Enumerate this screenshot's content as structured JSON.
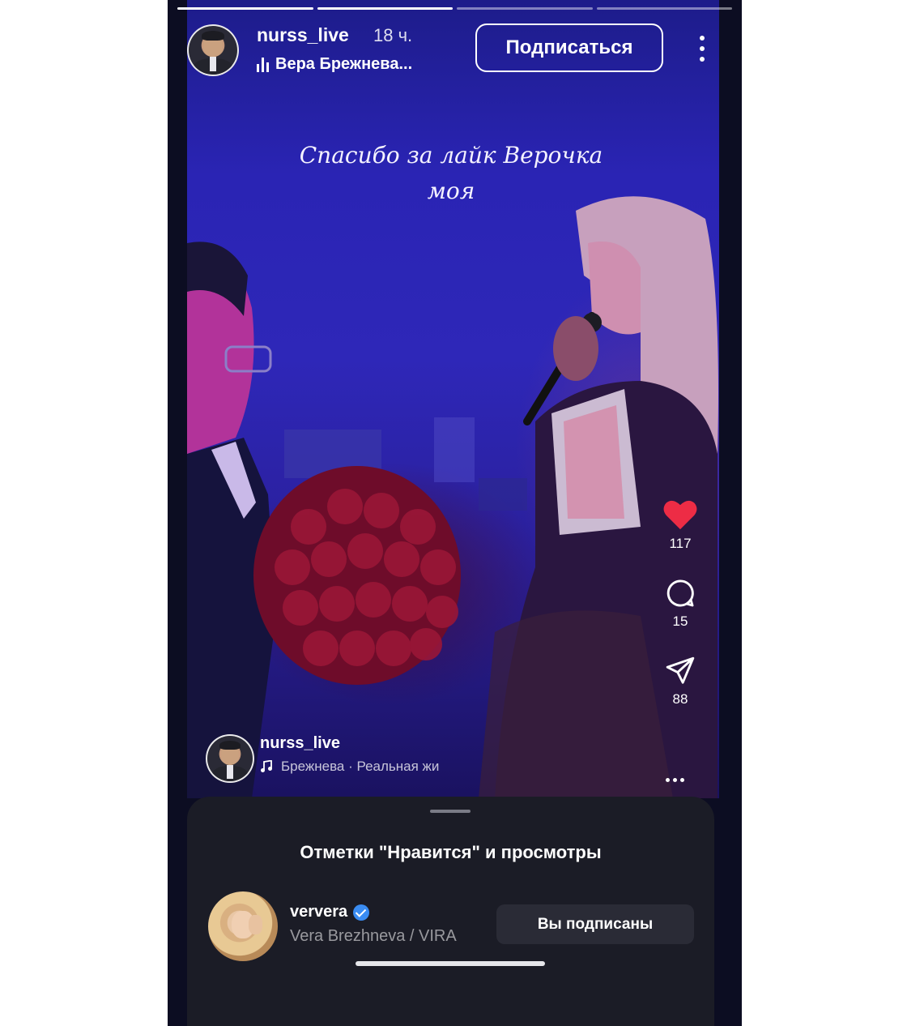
{
  "story": {
    "username": "nurss_live",
    "time_ago": "18 ч.",
    "music_label": "Вера Брежнева...",
    "follow_button": "Подписаться",
    "progress_segments": 4,
    "progress_active": 2,
    "caption_line1": "Спасибо за лайк Верочка",
    "caption_line2": "моя"
  },
  "reel": {
    "username": "nurss_live",
    "music": "Брежнева · Реальная жи",
    "likes": "117",
    "comments": "15",
    "shares": "88",
    "like_color": "#ed2c45"
  },
  "sheet": {
    "title": "Отметки \"Нравится\" и просмотры",
    "user": {
      "handle": "ververa",
      "name": "Vera Brezhneva / VIRA",
      "verified": true,
      "button": "Вы подписаны"
    }
  },
  "icons": [
    "more-vertical-icon",
    "audio-bars-icon",
    "heart-icon",
    "comment-icon",
    "share-icon",
    "music-note-icon",
    "verified-icon",
    "more-horizontal-icon"
  ]
}
